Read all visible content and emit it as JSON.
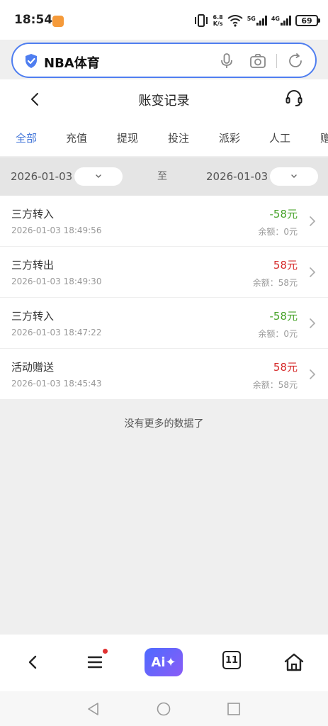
{
  "status_bar": {
    "time": "18:54",
    "speed_value": "6.8",
    "speed_unit": "K/s",
    "network_1": "5G",
    "network_2": "4G",
    "battery": "69"
  },
  "url_bar": {
    "text": "NBA体育"
  },
  "header": {
    "title": "账变记录"
  },
  "tabs": [
    {
      "label": "全部",
      "active": true
    },
    {
      "label": "充值"
    },
    {
      "label": "提现"
    },
    {
      "label": "投注"
    },
    {
      "label": "派彩"
    },
    {
      "label": "人工"
    },
    {
      "label": "赠"
    }
  ],
  "date_filter": {
    "start_date": "2026-01-03",
    "separator": "至",
    "end_date": "2026-01-03"
  },
  "records": [
    {
      "title": "三方转入",
      "time": "2026-01-03 18:49:56",
      "amount": "-58元",
      "balance": "余额：0元"
    },
    {
      "title": "三方转出",
      "time": "2026-01-03 18:49:30",
      "amount": "58元",
      "balance": "余额：58元"
    },
    {
      "title": "三方转入",
      "time": "2026-01-03 18:47:22",
      "amount": "-58元",
      "balance": "余额：0元"
    },
    {
      "title": "活动赠送",
      "time": "2026-01-03 18:45:43",
      "amount": "58元",
      "balance": "余额：58元"
    }
  ],
  "no_more_text": "没有更多的数据了",
  "browser_bar": {
    "ai_label": "Ai✦",
    "tab_count": "11"
  },
  "colors": {
    "accent": "#3f73d8",
    "negative_amount": "#47a329",
    "positive_amount": "#d62b2b"
  }
}
